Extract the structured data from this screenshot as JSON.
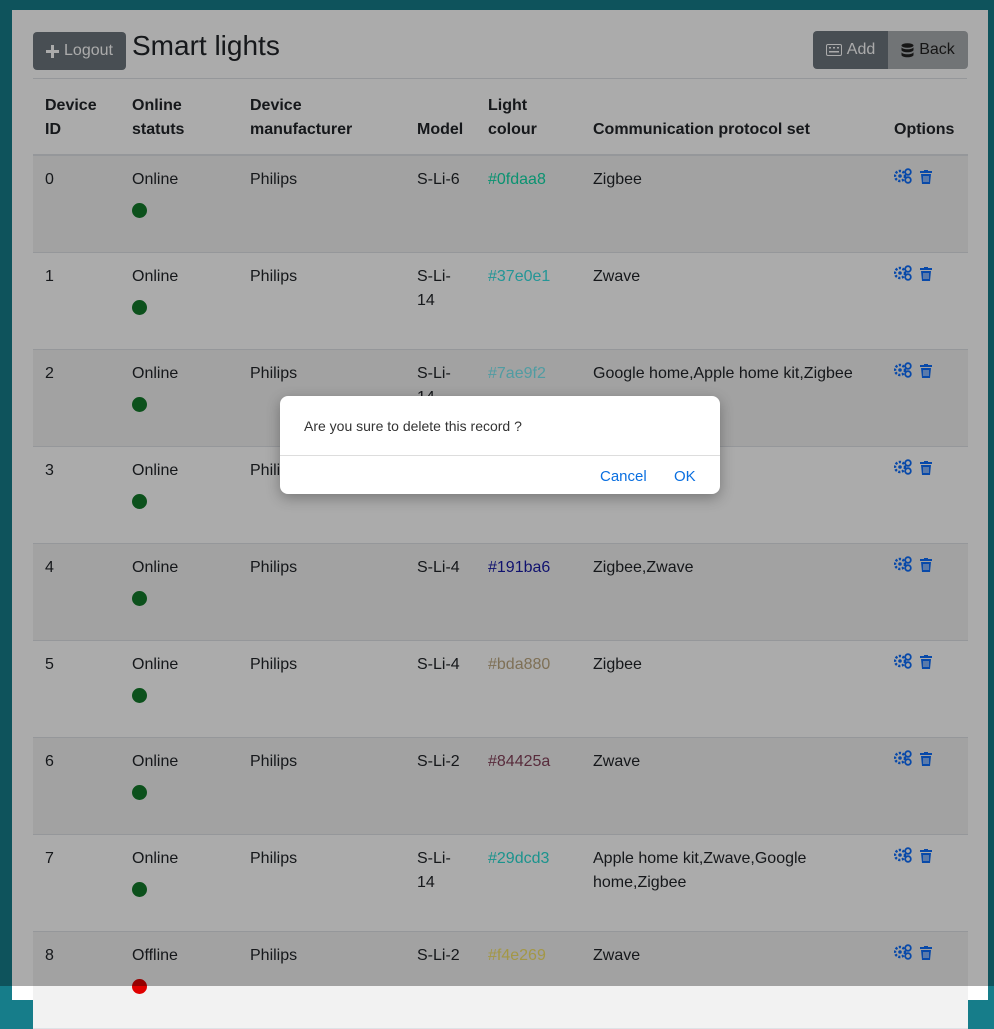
{
  "header": {
    "logout_label": "Logout",
    "title": "Smart lights",
    "add_label": "Add",
    "back_label": "Back"
  },
  "table": {
    "columns": [
      "Device ID",
      "Online statuts",
      "Device manufacturer",
      "Model",
      "Light colour",
      "Communication protocol set",
      "Options"
    ],
    "rows": [
      {
        "id": "0",
        "status": "Online",
        "status_color": "#137a2a",
        "manufacturer": "Philips",
        "model": "S-Li-6",
        "colour": "#0fdaa8",
        "protocols": "Zigbee"
      },
      {
        "id": "1",
        "status": "Online",
        "status_color": "#137a2a",
        "manufacturer": "Philips",
        "model": "S-Li-14",
        "colour": "#37e0e1",
        "protocols": "Zwave"
      },
      {
        "id": "2",
        "status": "Online",
        "status_color": "#137a2a",
        "manufacturer": "Philips",
        "model": "S-Li-14",
        "colour": "#7ae9f2",
        "protocols": "Google home,Apple home kit,Zigbee"
      },
      {
        "id": "3",
        "status": "Online",
        "status_color": "#137a2a",
        "manufacturer": "Philips",
        "model": "",
        "colour": "",
        "protocols": ""
      },
      {
        "id": "4",
        "status": "Online",
        "status_color": "#137a2a",
        "manufacturer": "Philips",
        "model": "S-Li-4",
        "colour": "#191ba6",
        "protocols": "Zigbee,Zwave"
      },
      {
        "id": "5",
        "status": "Online",
        "status_color": "#137a2a",
        "manufacturer": "Philips",
        "model": "S-Li-4",
        "colour": "#bda880",
        "protocols": "Zigbee"
      },
      {
        "id": "6",
        "status": "Online",
        "status_color": "#137a2a",
        "manufacturer": "Philips",
        "model": "S-Li-2",
        "colour": "#84425a",
        "protocols": "Zwave"
      },
      {
        "id": "7",
        "status": "Online",
        "status_color": "#137a2a",
        "manufacturer": "Philips",
        "model": "S-Li-14",
        "colour": "#29dcd3",
        "protocols": "Apple home kit,Zwave,Google home,Zigbee"
      },
      {
        "id": "8",
        "status": "Offline",
        "status_color": "#e00000",
        "manufacturer": "Philips",
        "model": "S-Li-2",
        "colour": "#f4e269",
        "protocols": "Zwave"
      }
    ]
  },
  "dialog": {
    "message": "Are you sure to delete this record ?",
    "cancel_label": "Cancel",
    "ok_label": "OK"
  },
  "icons": {
    "logout": "plus-icon",
    "add": "keyboard-icon",
    "back": "database-icon",
    "edit": "gears-icon",
    "delete": "trash-icon"
  }
}
